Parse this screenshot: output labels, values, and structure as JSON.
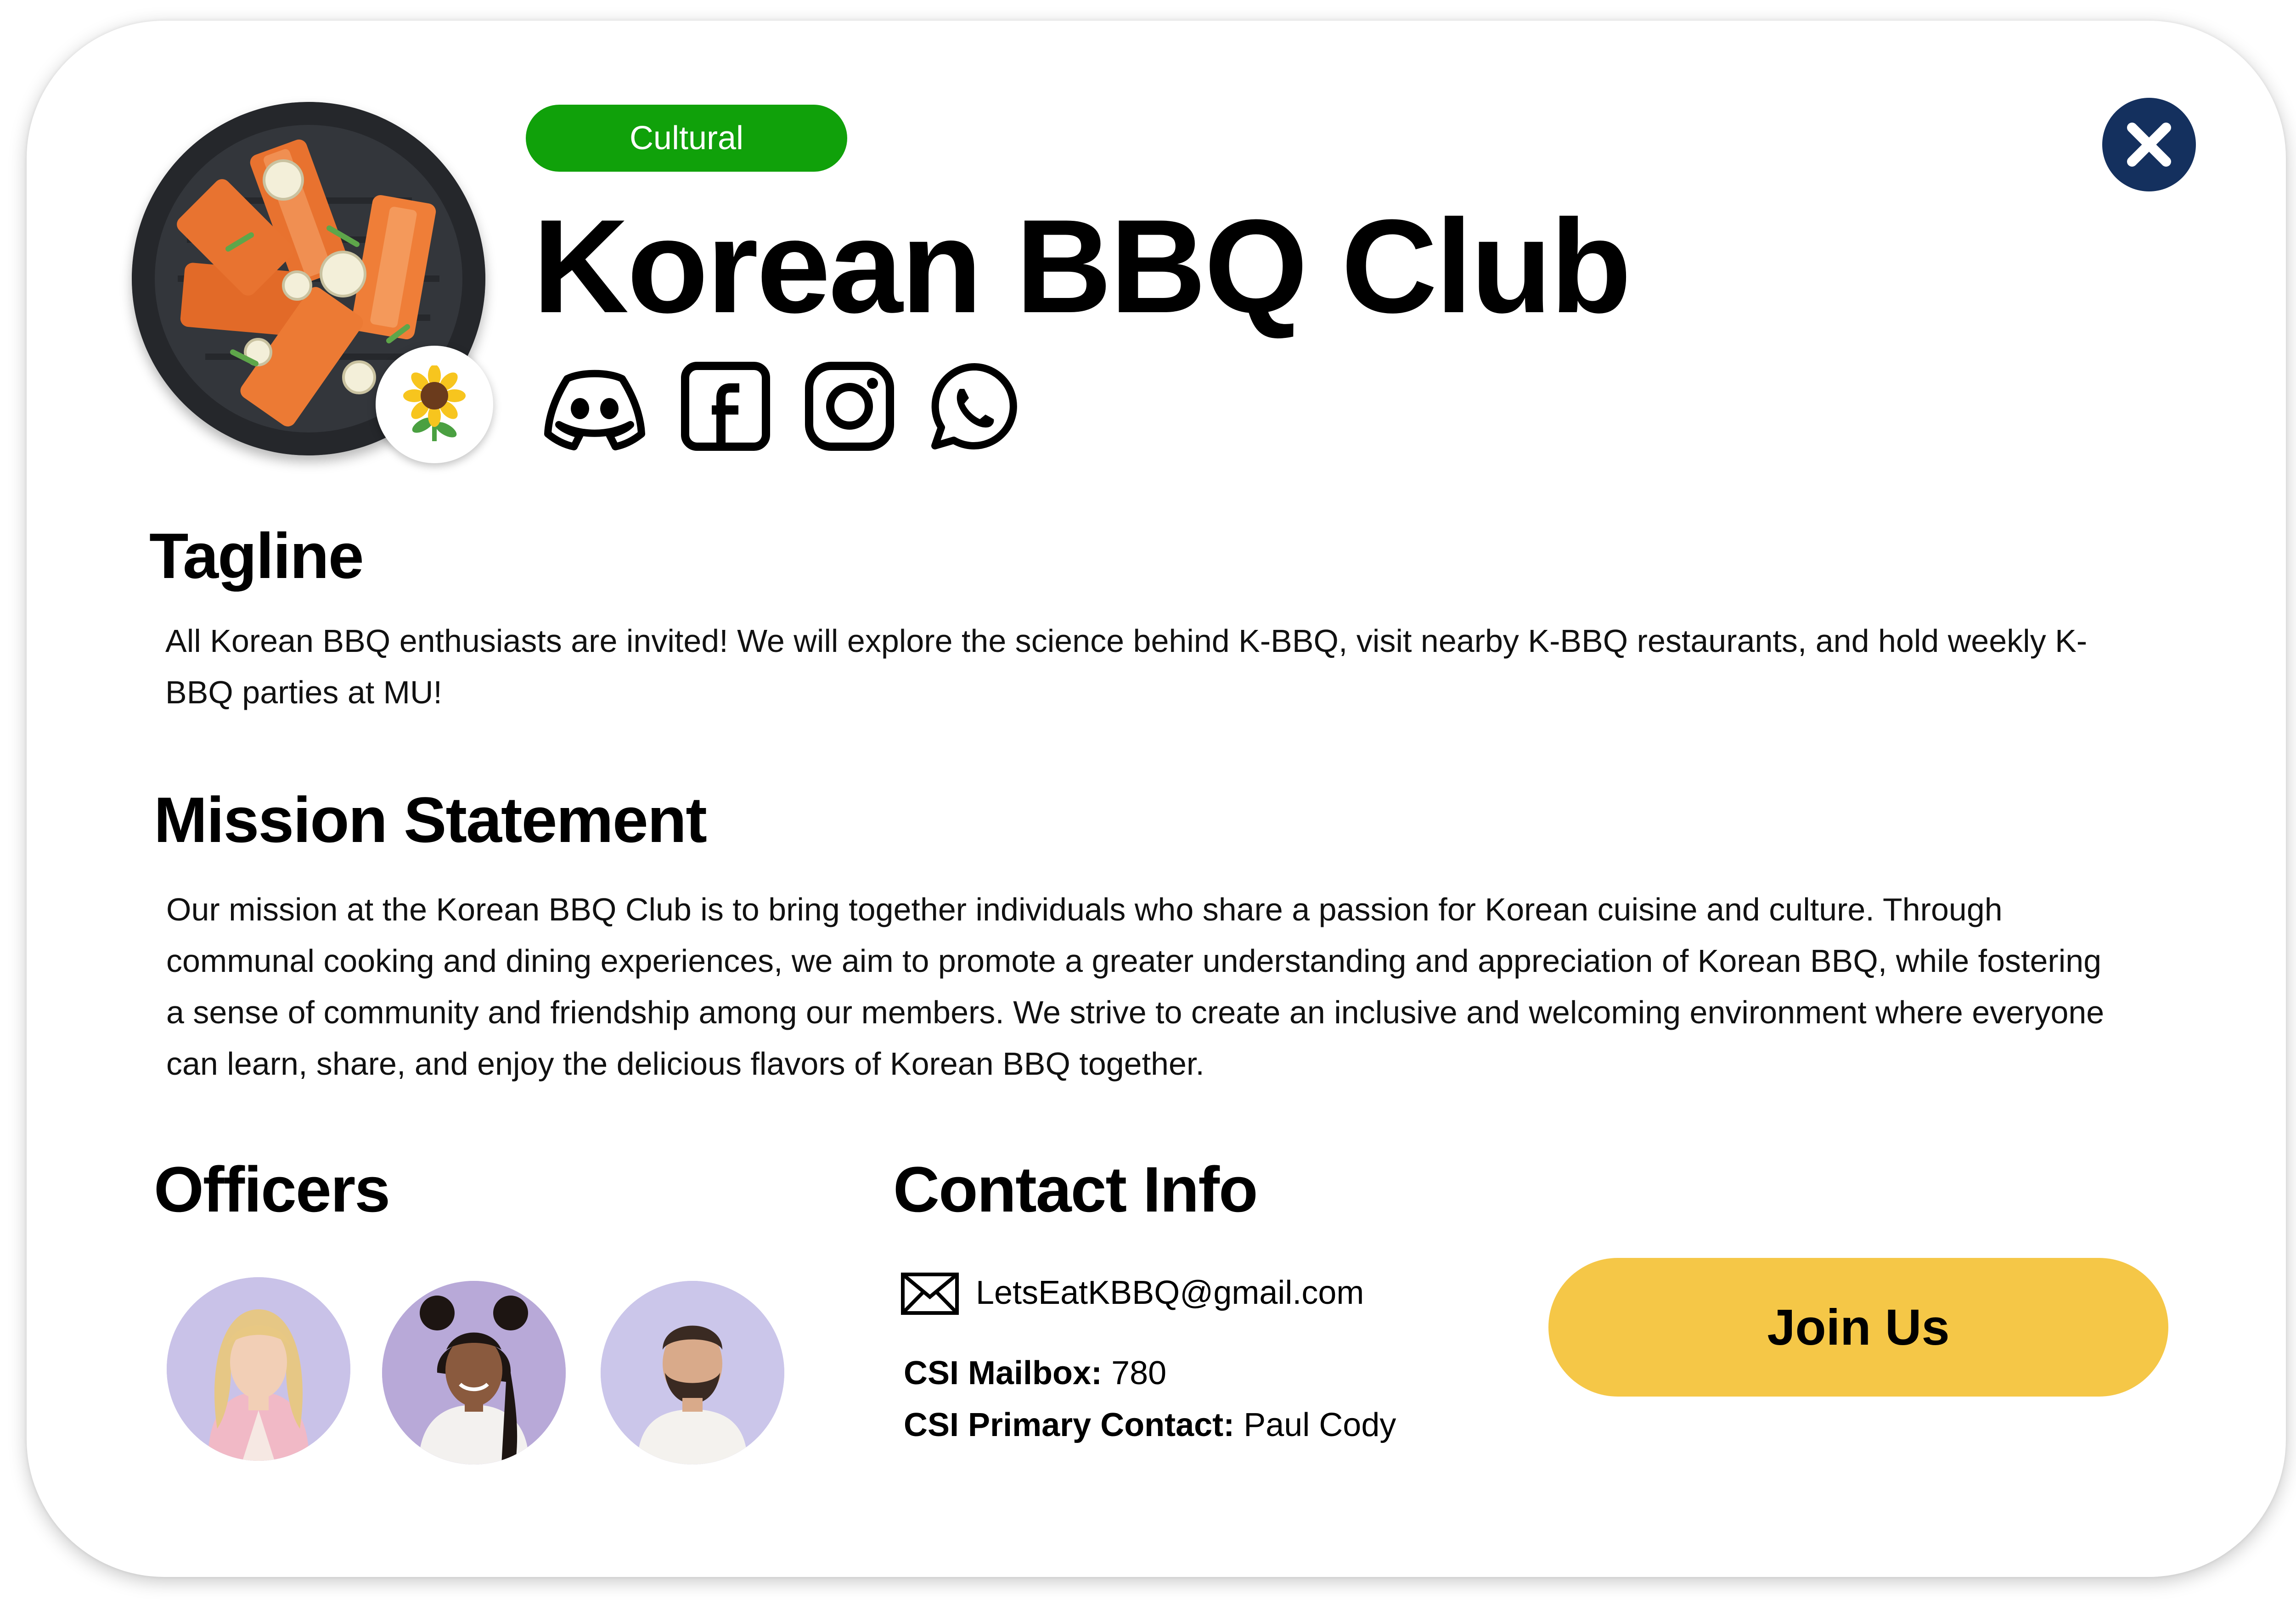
{
  "club": {
    "category": "Cultural",
    "name": "Korean BBQ Club",
    "badge_emoji": "🌻"
  },
  "social_icons": [
    "discord-icon",
    "facebook-icon",
    "instagram-icon",
    "whatsapp-icon"
  ],
  "tagline": {
    "heading": "Tagline",
    "text": "All Korean BBQ enthusiasts are invited! We will explore the science behind K-BBQ, visit nearby K-BBQ restaurants, and hold weekly K-BBQ parties at MU!"
  },
  "mission": {
    "heading": "Mission Statement",
    "text": "Our mission at the Korean BBQ Club is to bring together individuals who share a passion for Korean cuisine and culture. Through communal cooking and dining experiences, we aim to promote a greater understanding and appreciation of Korean BBQ, while fostering a sense of community and friendship among our members. We strive to create an inclusive and welcoming environment where everyone can learn, share, and enjoy the delicious flavors of Korean BBQ together."
  },
  "officers": {
    "heading": "Officers"
  },
  "contact": {
    "heading": "Contact Info",
    "email": "LetsEatKBBQ@gmail.com",
    "mailbox_label": "CSI Mailbox:",
    "mailbox_value": "780",
    "primary_label": "CSI Primary Contact:",
    "primary_value": "Paul Cody"
  },
  "actions": {
    "join_label": "Join Us"
  },
  "colors": {
    "category_tag": "#10a10a",
    "close_button": "#14305e",
    "join_button": "#f5c747",
    "officer_bg": "#c7c3e6"
  }
}
